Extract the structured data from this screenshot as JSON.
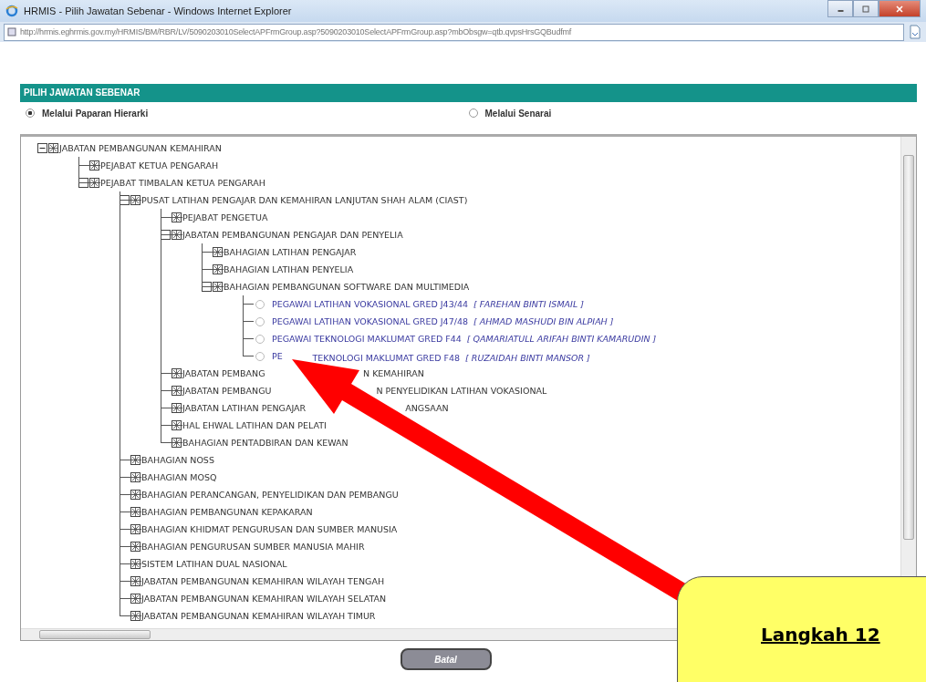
{
  "window": {
    "title": "HRMIS - Pilih Jawatan Sebenar - Windows Internet Explorer"
  },
  "address_bar": {
    "url": "http://hrmis.eghrmis.gov.my/HRMIS/BM/RBR/LV/5090203010SelectAPFrmGroup.asp?5090203010SelectAPFrmGroup.asp?mbObsgw=qtb.qvpsHrsGQBudfmf"
  },
  "panel": {
    "title": "PILIH JAWATAN SEBENAR"
  },
  "view_options": [
    {
      "label": "Melalui Paparan Hierarki",
      "selected": true
    },
    {
      "label": "Melalui Senarai",
      "selected": false
    }
  ],
  "tree": [
    {
      "kind": "unit",
      "label": "JABATAN PEMBANGUNAN KEMAHIRAN",
      "expanded": true,
      "children": [
        {
          "kind": "unit",
          "label": "PEJABAT KETUA PENGARAH",
          "expanded": false
        },
        {
          "kind": "unit",
          "label": "PEJABAT TIMBALAN KETUA PENGARAH",
          "expanded": true,
          "children": [
            {
              "kind": "unit",
              "label": "PUSAT LATIHAN PENGAJAR DAN KEMAHIRAN LANJUTAN SHAH ALAM (CIAST)",
              "expanded": true,
              "children": [
                {
                  "kind": "unit",
                  "label": "PEJABAT PENGETUA",
                  "expanded": false
                },
                {
                  "kind": "unit",
                  "label": "JABATAN PEMBANGUNAN PENGAJAR DAN PENYELIA",
                  "expanded": true,
                  "children": [
                    {
                      "kind": "unit",
                      "label": "BAHAGIAN LATIHAN PENGAJAR",
                      "expanded": false
                    },
                    {
                      "kind": "unit",
                      "label": "BAHAGIAN LATIHAN PENYELIA",
                      "expanded": false
                    },
                    {
                      "kind": "unit",
                      "label": "BAHAGIAN PEMBANGUNAN SOFTWARE DAN MULTIMEDIA",
                      "expanded": true,
                      "children": [
                        {
                          "kind": "position",
                          "label": "PEGAWAI LATIHAN VOKASIONAL GRED J43/44",
                          "holder": "[ FAREHAN BINTI ISMAIL ]",
                          "selected": false
                        },
                        {
                          "kind": "position",
                          "label": "PEGAWAI LATIHAN VOKASIONAL GRED J47/48",
                          "holder": "[ AHMAD MASHUDI BIN ALPIAH ]",
                          "selected": false
                        },
                        {
                          "kind": "position",
                          "label": "PEGAWAI TEKNOLOGI MAKLUMAT GRED F44",
                          "holder": "[ QAMARIATULL ARIFAH BINTI KAMARUDIN ]",
                          "selected": false
                        },
                        {
                          "kind": "position",
                          "label": "PE",
                          "label_tail": "TEKNOLOGI MAKLUMAT GRED F48",
                          "holder": "[ RUZAIDAH BINTI MANSOR ]",
                          "selected": false
                        }
                      ]
                    }
                  ]
                },
                {
                  "kind": "unit",
                  "label": "JABATAN PEMBANG",
                  "label_tail": "N KEMAHIRAN",
                  "expanded": false
                },
                {
                  "kind": "unit",
                  "label": "JABATAN PEMBANGU",
                  "label_tail": "N PENYELIDIKAN LATIHAN VOKASIONAL",
                  "expanded": false
                },
                {
                  "kind": "unit",
                  "label": "JABATAN LATIHAN PENGAJAR",
                  "label_tail": "ANGSAAN",
                  "expanded": false
                },
                {
                  "kind": "unit",
                  "label": "HAL EHWAL LATIHAN DAN PELATI",
                  "expanded": false
                },
                {
                  "kind": "unit",
                  "label": "BAHAGIAN PENTADBIRAN DAN KEWAN",
                  "expanded": false
                }
              ]
            },
            {
              "kind": "unit",
              "label": "BAHAGIAN NOSS",
              "expanded": false
            },
            {
              "kind": "unit",
              "label": "BAHAGIAN MOSQ",
              "expanded": false
            },
            {
              "kind": "unit",
              "label": "BAHAGIAN PERANCANGAN, PENYELIDIKAN DAN PEMBANGU",
              "expanded": false
            },
            {
              "kind": "unit",
              "label": "BAHAGIAN PEMBANGUNAN KEPAKARAN",
              "expanded": false
            },
            {
              "kind": "unit",
              "label": "BAHAGIAN KHIDMAT PENGURUSAN DAN SUMBER MANUSIA",
              "expanded": false
            },
            {
              "kind": "unit",
              "label": "BAHAGIAN PENGURUSAN SUMBER MANUSIA MAHIR",
              "expanded": false
            },
            {
              "kind": "unit",
              "label": "SISTEM LATIHAN DUAL NASIONAL",
              "expanded": false
            },
            {
              "kind": "unit",
              "label": "JABATAN PEMBANGUNAN KEMAHIRAN WILAYAH TENGAH",
              "expanded": false
            },
            {
              "kind": "unit",
              "label": "JABATAN PEMBANGUNAN KEMAHIRAN WILAYAH SELATAN",
              "expanded": false
            },
            {
              "kind": "unit",
              "label": "JABATAN PEMBANGUNAN KEMAHIRAN WILAYAH TIMUR",
              "expanded": false
            }
          ]
        }
      ]
    }
  ],
  "buttons": [
    {
      "label": "Batal"
    }
  ],
  "callout": {
    "title": "Langkah 12"
  }
}
